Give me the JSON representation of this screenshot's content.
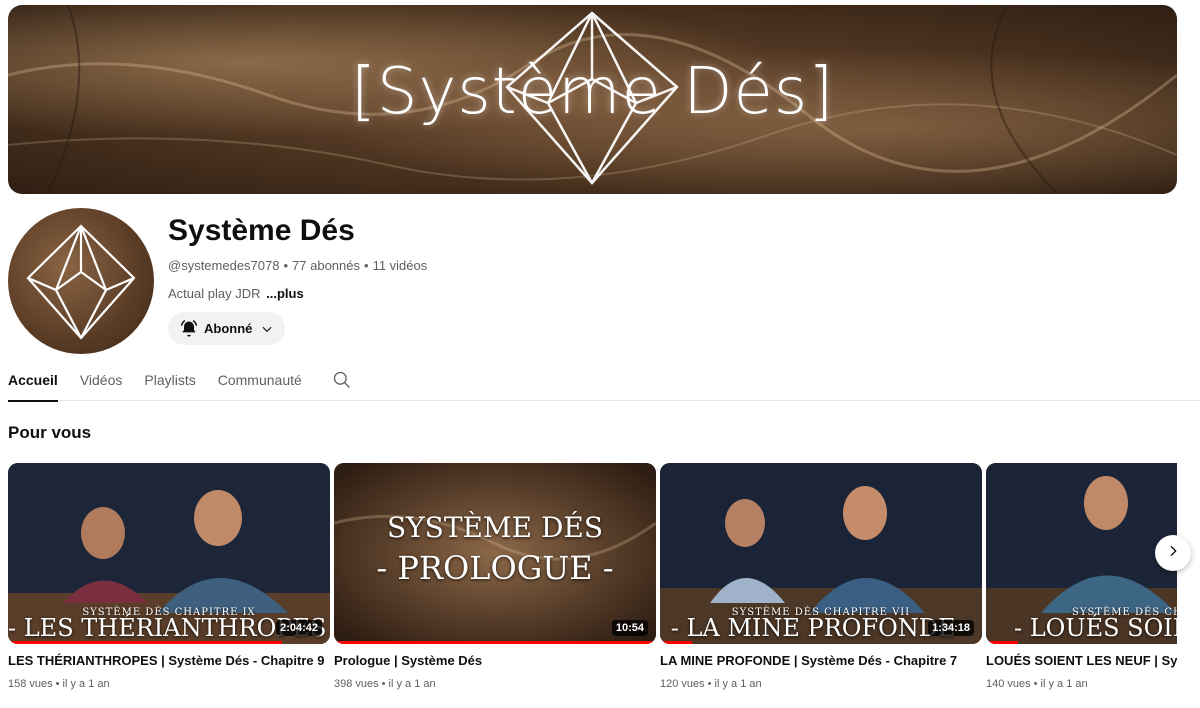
{
  "banner": {
    "title": "[Système Dés]"
  },
  "channel": {
    "name": "Système Dés",
    "handle": "@systemedes7078",
    "subscribers": "77 abonnés",
    "video_count": "11 vidéos",
    "meta_separator": "•",
    "description": "Actual play JDR",
    "more_label": "...plus",
    "subscribe_label": "Abonné"
  },
  "tabs": [
    {
      "label": "Accueil",
      "active": true
    },
    {
      "label": "Vidéos",
      "active": false
    },
    {
      "label": "Playlists",
      "active": false
    },
    {
      "label": "Communauté",
      "active": false
    }
  ],
  "section": {
    "title": "Pour vous"
  },
  "videos": [
    {
      "title": "LES THÉRIANTHROPES | Système Dés - Chapitre 9",
      "views": "158 vues",
      "age": "il y a 1 an",
      "duration": "2:04:42",
      "thumb_chapter": "SYSTÈME DÉS  CHAPITRE IX",
      "thumb_big": "- LES THÉRIANTHROPES -",
      "watched_fraction": 0.85
    },
    {
      "title": "Prologue | Système Dés",
      "views": "398 vues",
      "age": "il y a 1 an",
      "duration": "10:54",
      "thumb_line1": "SYSTÈME DÉS",
      "thumb_line2": "- PROLOGUE -",
      "watched_fraction": 1.0
    },
    {
      "title": "LA MINE PROFONDE | Système Dés - Chapitre 7",
      "views": "120 vues",
      "age": "il y a 1 an",
      "duration": "1:34:18",
      "thumb_chapter": "SYSTÈME DÉS  CHAPITRE VII",
      "thumb_big": "- LA MINE PROFONDE -",
      "watched_fraction": 0.1
    },
    {
      "title": "LOUÉS SOIENT LES NEUF | Système Dés",
      "views": "140 vues",
      "age": "il y a 1 an",
      "thumb_chapter": "SYSTÈME DÉS  CHAPITRE",
      "thumb_big": "- LOUÉS SOIENT LES",
      "watched_fraction": 0.1
    }
  ],
  "meta_separator": "•",
  "icons": {
    "bell": "bell-icon",
    "chevron": "chevron-down-icon",
    "search": "search-icon",
    "next": "chevron-right-icon"
  },
  "colors": {
    "progress": "#ff0000",
    "text_primary": "#0f0f0f",
    "text_secondary": "#606060"
  }
}
